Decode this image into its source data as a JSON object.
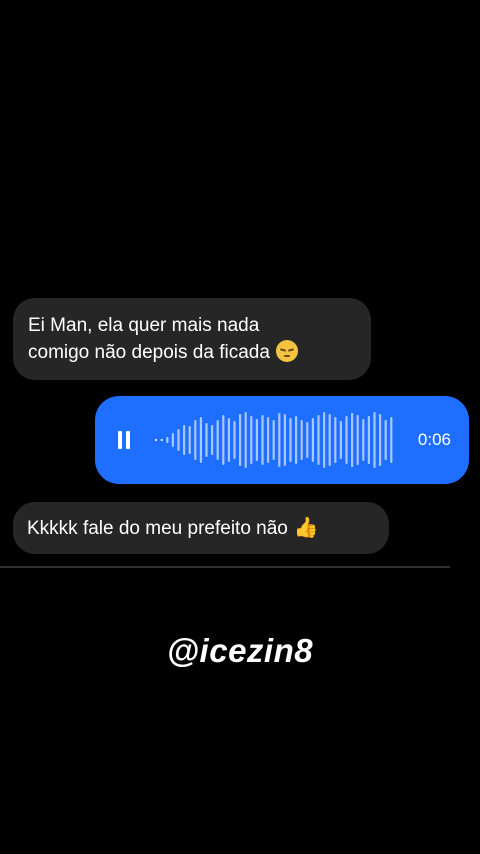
{
  "messages": {
    "first": {
      "line1": "Ei Man, ela quer mais nada",
      "line2": "comigo não depois da ficada",
      "emoji": "pensive-face-emoji"
    },
    "voice": {
      "duration": "0:06",
      "state": "playing",
      "color": "#1e6fff"
    },
    "second": {
      "text": "Kkkkk fale do meu prefeito não",
      "emoji": "👍"
    }
  },
  "watermark": "@icezin8",
  "colors": {
    "background": "#000000",
    "incoming_bubble": "#262626",
    "outgoing_bubble": "#1e6fff"
  }
}
